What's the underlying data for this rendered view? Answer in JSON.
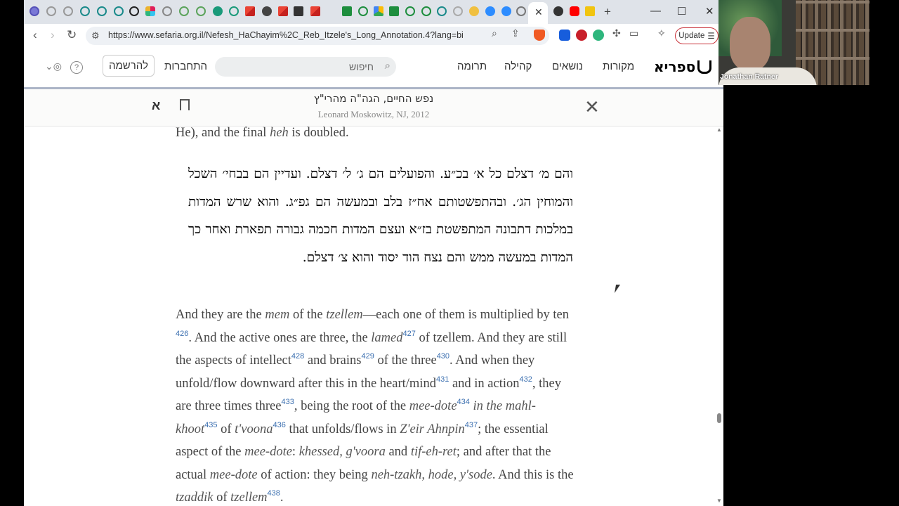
{
  "browser": {
    "url": "https://www.sefaria.org.il/Nefesh_HaChayim%2C_Reb_Itzele's_Long_Annotation.4?lang=bi",
    "update_label": "Update",
    "active_tab_close": "✕",
    "new_tab": "+",
    "window_controls": [
      "—",
      "☐",
      "✕"
    ]
  },
  "site_nav": {
    "logo_text": "ספריא",
    "links": [
      "מקורות",
      "נושאים",
      "קהילה",
      "תרומה"
    ],
    "search_placeholder": "חיפוש",
    "login": "התחברות",
    "signup": "להרשמה",
    "help": "?",
    "globe": "🌐"
  },
  "reader": {
    "book_title": "נפש החיים, הגה\"ה מהרי\"ץ",
    "book_subtitle": "Leonard Moskowitz, NJ, 2012",
    "close": "✕",
    "aleph": "א",
    "prev_english_lines": [
      "He), and the final",
      "heh",
      "is doubled."
    ],
    "hebrew": "והם מ׳ דצלם כל א׳ בכ״ע. והפועלים הם ג׳ ל׳ דצלם. ועדיין הם בבחי׳ השכל והמוחין הג׳. ובהתפשטותם אח״ז בלב ובמעשה הם גפ״ג. והוא שרש המדות במלכות דתבונה המתפשטת בז״א ועצם המדות חכמה גבורה תפארת ואחר כך המדות במעשה ממש והם נצח הוד יסוד והוא צ׳ דצלם.",
    "english": {
      "s1": "And they are the ",
      "i1": "mem",
      "s2": " of the ",
      "i2": "tzellem",
      "s3": "—each one of them is multiplied by ten",
      "n426": "426",
      "s4": ". And the active ones are three, the ",
      "i3": "lamed",
      "n427": "427",
      "s5": " of tzellem. And they are still the aspects of intellect",
      "n428": "428",
      "s6": " and brains",
      "n429": "429",
      "s7": " of the three",
      "n430": "430",
      "s8": ". And when they unfold/flow downward after this in the heart/mind",
      "n431": "431",
      "s9": " and in action",
      "n432": "432",
      "s10": ", they are three times three",
      "n433": "433",
      "s11": ", being the root of the ",
      "i4": "mee-dote",
      "n434": "434",
      "i5": " in the mahl-khoot",
      "n435": "435",
      "s12": " of ",
      "i6": "t'voona",
      "n436": "436",
      "s13": " that unfolds/flows in ",
      "i7": "Z'eir Ahnpin",
      "n437": "437",
      "s14": "; the essential aspect of the ",
      "i8": "mee-dote",
      "s15": ": ",
      "i9": "khessed, g'voora",
      "s16": " and ",
      "i10": "tif-eh-ret",
      "s17": "; and after that the actual ",
      "i11": "mee-dote",
      "s18": " of action: they being ",
      "i12": "neh-tzakh, hode, y'sode",
      "s19": ". And this is the ",
      "i13": "tzaddik",
      "s20": " of ",
      "i14": "tzellem",
      "n438": "438",
      "s21": "."
    }
  },
  "webcam": {
    "name": "Jonathan Ratner"
  },
  "colors": {
    "accent_blue": "#3b6fb0",
    "update_red": "#c9323a",
    "tabbar": "#dfe3e9",
    "header_rule": "#acb5c7"
  }
}
